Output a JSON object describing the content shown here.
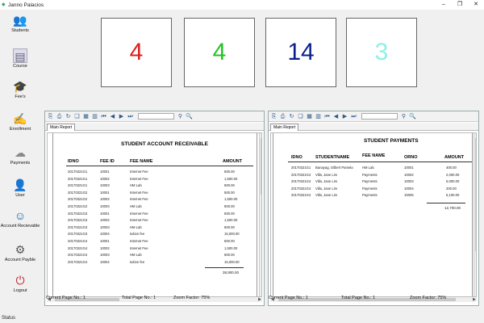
{
  "window": {
    "title": "Janno Palacios",
    "controls": {
      "minimize": "–",
      "restore": "❐",
      "close": "✕"
    }
  },
  "sidebar": {
    "items": [
      {
        "label": "Students",
        "icon": "students-icon"
      },
      {
        "label": "Course",
        "icon": "course-icon"
      },
      {
        "label": "Fee's",
        "icon": "graduation-cap-icon"
      },
      {
        "label": "Enrollment",
        "icon": "enrollment-icon"
      },
      {
        "label": "Payments",
        "icon": "payments-icon"
      },
      {
        "label": "User",
        "icon": "user-icon"
      },
      {
        "label": "Account Recievable",
        "icon": "account-receivable-icon"
      },
      {
        "label": "Account Payble",
        "icon": "account-payable-icon"
      },
      {
        "label": "Logout",
        "icon": "logout-icon"
      }
    ]
  },
  "cards": [
    {
      "value": "4",
      "color": "#e01d1d"
    },
    {
      "value": "4",
      "color": "#22c422"
    },
    {
      "value": "14",
      "color": "#0b1f8a"
    },
    {
      "value": "3",
      "color": "#8ff0e6"
    }
  ],
  "left_report": {
    "tab": "Main Report",
    "title": "STUDENT ACCOUNT RECEIVABLE",
    "headers": [
      "IDNO",
      "FEE ID",
      "FEE NAME",
      "AMOUNT"
    ],
    "rows": [
      [
        "20170321G1",
        "10001",
        "Internet Fee",
        "500.00"
      ],
      [
        "20170321G1",
        "10002",
        "Internet Fee",
        "1,500.00"
      ],
      [
        "20170321G1",
        "10003",
        "HM Lab",
        "600.00"
      ],
      [
        "20170321G2",
        "10001",
        "Internet Fee",
        "500.00"
      ],
      [
        "20170321G2",
        "10002",
        "Internet Fee",
        "1,500.00"
      ],
      [
        "20170321G2",
        "10003",
        "HM Lab",
        "600.00"
      ],
      [
        "20170321G3",
        "10001",
        "Internet Fee",
        "500.00"
      ],
      [
        "20170321G3",
        "10002",
        "Internet Fee",
        "1,500.00"
      ],
      [
        "20170321G3",
        "10003",
        "HM Lab",
        "600.00"
      ],
      [
        "20170321G3",
        "10004",
        "tuition fee",
        "15,000.00"
      ],
      [
        "20170321G4",
        "10001",
        "Internet Fee",
        "500.00"
      ],
      [
        "20170321G4",
        "10002",
        "Internet Fee",
        "1,500.00"
      ],
      [
        "20170321G4",
        "10003",
        "HM Lab",
        "600.00"
      ],
      [
        "20170321G4",
        "10004",
        "tuition fee",
        "15,000.00"
      ]
    ],
    "total": "38,900.00",
    "status": {
      "page": "Current Page No.: 1",
      "total": "Total Page No.: 1",
      "zoom": "Zoom Factor: 75%"
    }
  },
  "right_report": {
    "tab": "Main Report",
    "title": "STUDENT PAYMENTS",
    "headers": [
      "IDNO",
      "STUDENTNAME",
      "FEE NAME",
      "ORNO",
      "AMOUNT"
    ],
    "rows": [
      [
        "20170321G1",
        "Banayag, Gilbert Pamela",
        "HM Lab",
        "10001",
        "400.00"
      ],
      [
        "20170321G4",
        "Villa, Jane Lim",
        "Payments",
        "10002",
        "2,000.00"
      ],
      [
        "20170321G4",
        "Villa, Jane Lim",
        "Payments",
        "10003",
        "5,000.00"
      ],
      [
        "20170321G4",
        "Villa, Jane Lim",
        "Payments",
        "10004",
        "200.00"
      ],
      [
        "20170321G4",
        "Villa, Jane Lim",
        "Payments",
        "10005",
        "5,100.00"
      ]
    ],
    "total": "12,700.00",
    "status": {
      "page": "Current Page No.: 1",
      "total": "Total Page No.: 1",
      "zoom": "Zoom Factor: 75%"
    }
  },
  "app_status": "Status"
}
